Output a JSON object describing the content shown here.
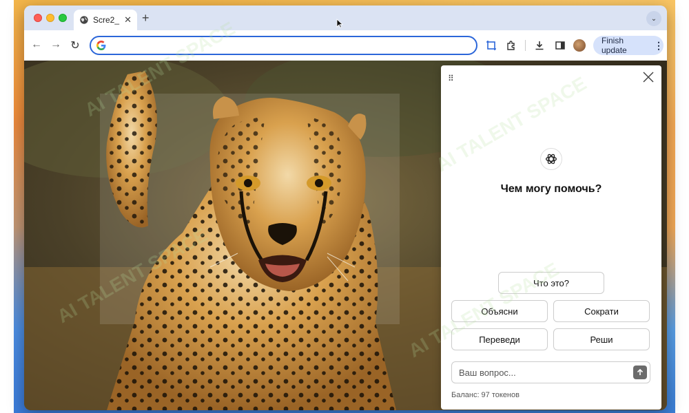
{
  "browser": {
    "tab": {
      "title": "Scre2_"
    },
    "omnibox": {
      "value": "",
      "placeholder": ""
    },
    "update_button": {
      "label": "Finish update"
    }
  },
  "panel": {
    "greeting": "Чем могу помочь?",
    "quick_actions": {
      "what": "Что это?",
      "explain": "Объясни",
      "shorten": "Сократи",
      "translate": "Переведи",
      "solve": "Реши"
    },
    "ask_placeholder": "Ваш вопрос...",
    "balance": "Баланс: 97 токенов"
  },
  "watermark_text": "AI TALENT SPACE",
  "colors": {
    "accent_blue": "#2b66d9",
    "update_bg": "#d6e2fb",
    "tabbar_bg": "#dbe3f3",
    "panel_bg": "#ffffff"
  },
  "icons": [
    "globe-icon",
    "close-icon",
    "plus-icon",
    "chevron-down-icon",
    "back-arrow-icon",
    "forward-arrow-icon",
    "reload-icon",
    "google-g-icon",
    "screenshot-select-icon",
    "extension-puzzle-icon",
    "download-icon",
    "side-panel-icon",
    "kebab-menu-icon",
    "drag-grip-icon",
    "openai-logo-icon",
    "send-arrow-icon"
  ]
}
